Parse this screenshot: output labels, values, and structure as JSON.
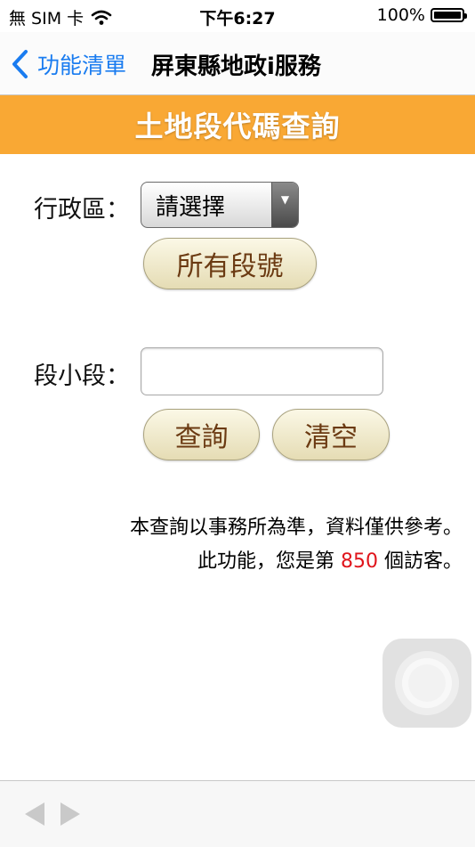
{
  "status_bar": {
    "carrier": "無 SIM 卡",
    "time": "下午6:27",
    "battery_percent": "100%",
    "battery_level": 1.0
  },
  "nav": {
    "back_label": "功能清單",
    "title": "屏東縣地政i服務"
  },
  "banner": {
    "title": "土地段代碼查詢"
  },
  "form": {
    "district_label": "行政區：",
    "district_selected": "請選擇",
    "all_sections_button": "所有段號",
    "section_label": "段小段：",
    "section_value": "",
    "query_button": "查詢",
    "clear_button": "清空"
  },
  "notes": {
    "line1": "本查詢以事務所為準，資料僅供參考。",
    "line2_prefix": "此功能，您是第",
    "visitor_count": "850",
    "line2_suffix": "個訪客。"
  },
  "colors": {
    "banner": "#f9a834",
    "link_blue": "#1a7cf0",
    "count_red": "#e0141b",
    "button_text": "#6b3a12"
  },
  "icons": {
    "back": "chevron-left-icon",
    "wifi": "wifi-icon",
    "battery": "battery-icon",
    "toolbar_back": "triangle-left-icon",
    "toolbar_forward": "triangle-right-icon"
  }
}
